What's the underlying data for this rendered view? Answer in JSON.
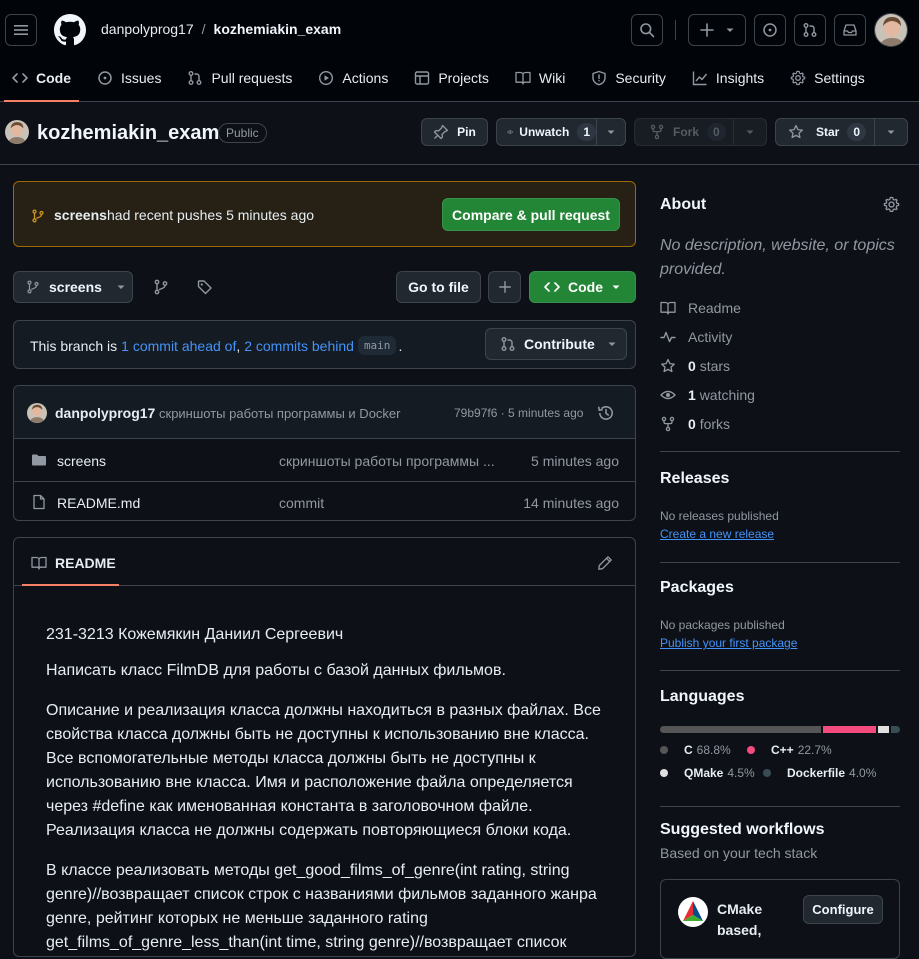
{
  "header": {
    "owner": "danpolyprog17",
    "separator": "/",
    "repo": "kozhemiakin_exam"
  },
  "tabs": [
    {
      "label": "Code",
      "icon": "code-icon",
      "selected": true
    },
    {
      "label": "Issues",
      "icon": "issue-icon"
    },
    {
      "label": "Pull requests",
      "icon": "pull-request-icon"
    },
    {
      "label": "Actions",
      "icon": "play-icon"
    },
    {
      "label": "Projects",
      "icon": "table-icon"
    },
    {
      "label": "Wiki",
      "icon": "book-icon"
    },
    {
      "label": "Security",
      "icon": "shield-icon"
    },
    {
      "label": "Insights",
      "icon": "graph-icon"
    },
    {
      "label": "Settings",
      "icon": "gear-icon"
    }
  ],
  "repo_row": {
    "name": "kozhemiakin_exam",
    "visibility": "Public",
    "pin": "Pin",
    "unwatch": "Unwatch",
    "watch_count": "1",
    "fork": "Fork",
    "fork_count": "0",
    "star": "Star",
    "star_count": "0"
  },
  "banner": {
    "branch": "screens",
    "text": "had recent pushes 5 minutes ago",
    "button": "Compare & pull request"
  },
  "toolbar": {
    "branch": "screens",
    "go_to_file": "Go to file",
    "code": "Code"
  },
  "compare": {
    "prefix": "This branch is",
    "ahead": "1 commit ahead of",
    "comma": ",",
    "behind": "2 commits behind",
    "base": "main",
    "period": ".",
    "contribute": "Contribute"
  },
  "commit": {
    "author": "danpolyprog17",
    "message": "скриншоты работы программы и Docker",
    "hash_time": "79b97f6 · 5 minutes ago"
  },
  "files": [
    {
      "name": "screens",
      "type": "folder",
      "message": "скриншоты работы программы ...",
      "time": "5 minutes ago"
    },
    {
      "name": "README.md",
      "type": "file",
      "message": "commit",
      "time": "14 minutes ago"
    }
  ],
  "readme": {
    "title": "README",
    "paragraphs": [
      "231-3213 Кожемякин Даниил Сергеевич",
      "Написать класс FilmDB для работы с базой данных фильмов.",
      "Описание и реализация класса должны находиться в разных файлах. Все свойства класса должны быть не доступны к использованию вне класса. Все вспомогательные методы класса должны быть не доступны к использованию вне класса. Имя и расположение файла определяется через #define как именованная константа в заголовочном файле. Реализация класса не должны содержать повторяющиеся блоки кода.",
      "В классе реализовать методы get_good_films_of_genre(int rating, string genre)//возвращает список строк с названиями фильмов заданного жанра genre, рейтинг которых не меньше заданного rating get_films_of_genre_less_than(int time, string genre)//возвращает список"
    ]
  },
  "about": {
    "title": "About",
    "description": "No description, website, or topics provided.",
    "items": [
      {
        "icon": "book-icon",
        "value": "",
        "label": "Readme"
      },
      {
        "icon": "pulse-icon",
        "value": "",
        "label": "Activity"
      },
      {
        "icon": "star-icon",
        "value": "0",
        "label": "stars"
      },
      {
        "icon": "eye-icon",
        "value": "1",
        "label": "watching"
      },
      {
        "icon": "fork-icon",
        "value": "0",
        "label": "forks"
      }
    ]
  },
  "releases": {
    "title": "Releases",
    "empty": "No releases published",
    "link": "Create a new release"
  },
  "packages": {
    "title": "Packages",
    "empty": "No packages published",
    "link": "Publish your first package"
  },
  "languages": {
    "title": "Languages",
    "items": [
      {
        "name": "C",
        "pct": "68.8%",
        "value": 68.8,
        "color": "#555555"
      },
      {
        "name": "C++",
        "pct": "22.7%",
        "value": 22.7,
        "color": "#f34b7d"
      },
      {
        "name": "QMake",
        "pct": "4.5%",
        "value": 4.5,
        "color": "#e0e0e0"
      },
      {
        "name": "Dockerfile",
        "pct": "4.0%",
        "value": 4.0,
        "color": "#384d54"
      }
    ]
  },
  "workflows": {
    "title": "Suggested workflows",
    "subtitle": "Based on your tech stack",
    "name": "CMake based,",
    "button": "Configure"
  }
}
